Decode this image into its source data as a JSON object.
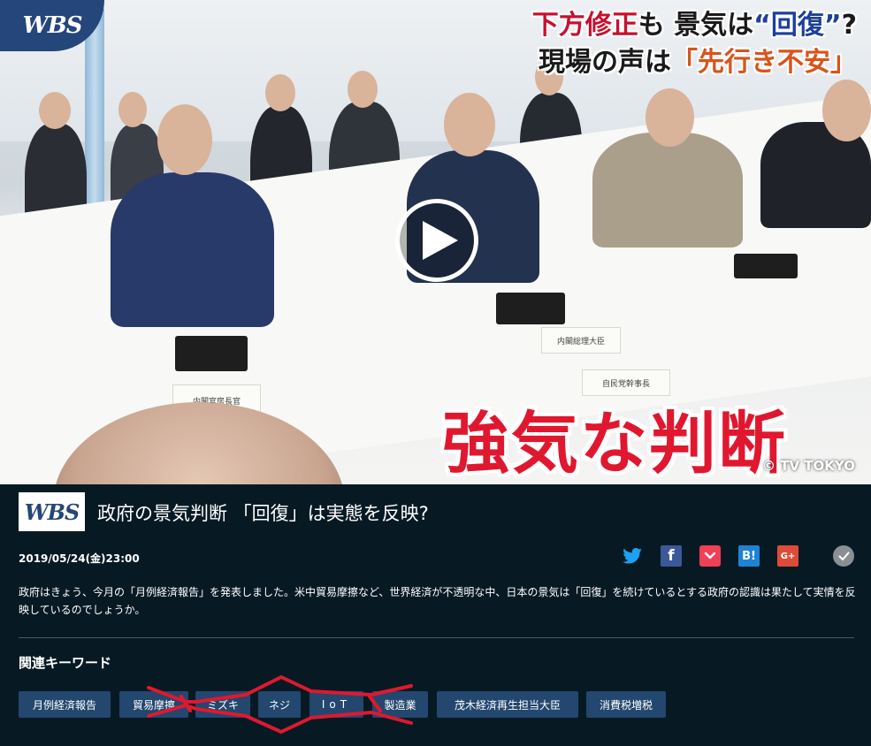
{
  "video": {
    "logo_text": "WBS",
    "caption_line1_red": "下方修正",
    "caption_line1_mid": "も 景気は",
    "caption_line1_blue": "“回復”",
    "caption_line1_end": "?",
    "caption_line2_black": "現場の声は",
    "caption_line2_orange": "「先行き不安」",
    "big_caption": "強気な判断",
    "copyright": "© TV TOKYO",
    "nameplates": [
      "内閣官房長官",
      "内閣総理大臣",
      "自民党幹事長"
    ],
    "play_icon": "play-icon"
  },
  "article": {
    "logo_text": "WBS",
    "title": "政府の景気判断 「回復」は実態を反映?",
    "date": "2019/05/24(金)23:00",
    "description": "政府はきょう、今月の「月例経済報告」を発表しました。米中貿易摩擦など、世界経済が不透明な中、日本の景気は「回復」を続けているとする政府の認識は果たして実情を反映しているのでしょうか。",
    "share": {
      "twitter_icon": "twitter-icon",
      "facebook_label": "f",
      "hatena_label": "B!",
      "google_label": "G+",
      "check_icon": "check-icon"
    }
  },
  "keywords": {
    "heading": "関連キーワード",
    "tags": [
      "月例経済報告",
      "貿易摩擦",
      "ミズキ",
      "ネジ",
      "IoT",
      "製造業",
      "茂木経済再生担当大臣",
      "消費税増税"
    ]
  },
  "colors": {
    "background": "#071a24",
    "tag_background": "#23476e",
    "annotation_red": "#e0182f"
  }
}
